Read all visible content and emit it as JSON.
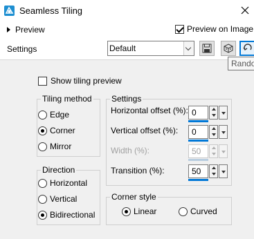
{
  "window": {
    "title": "Seamless Tiling",
    "close_symbol": "×"
  },
  "top": {
    "preview_label": "Preview",
    "preview_on_image_label": "Preview on Image",
    "preview_on_image_checked": true,
    "settings_label": "Settings",
    "preset_value": "Default",
    "tooltip_text": "Randomize"
  },
  "show_tiling_preview": {
    "label": "Show tiling preview",
    "checked": false
  },
  "tiling_method": {
    "title": "Tiling method",
    "options": [
      "Edge",
      "Corner",
      "Mirror"
    ],
    "selected": "Corner"
  },
  "direction": {
    "title": "Direction",
    "options": [
      "Horizontal",
      "Vertical",
      "Bidirectional"
    ],
    "selected": "Bidirectional"
  },
  "settings_group": {
    "title": "Settings",
    "horizontal_offset": {
      "label": "Horizontal offset (%):",
      "value": "0",
      "enabled": true
    },
    "vertical_offset": {
      "label": "Vertical offset (%):",
      "value": "0",
      "enabled": true
    },
    "width": {
      "label": "Width (%):",
      "value": "50",
      "enabled": false
    },
    "transition": {
      "label": "Transition (%):",
      "value": "50",
      "enabled": true
    }
  },
  "corner_style": {
    "title": "Corner style",
    "options": [
      "Linear",
      "Curved"
    ],
    "selected": "Linear"
  },
  "colors": {
    "accent": "#0078d7",
    "app_icon": "#1e8fd1",
    "disabled_text": "#a0a0a0"
  },
  "icons": {
    "app": "seamless-tiling-app-icon",
    "save": "floppy-disk-icon",
    "randomize": "dice-icon",
    "reset": "reset-arrow-icon"
  }
}
